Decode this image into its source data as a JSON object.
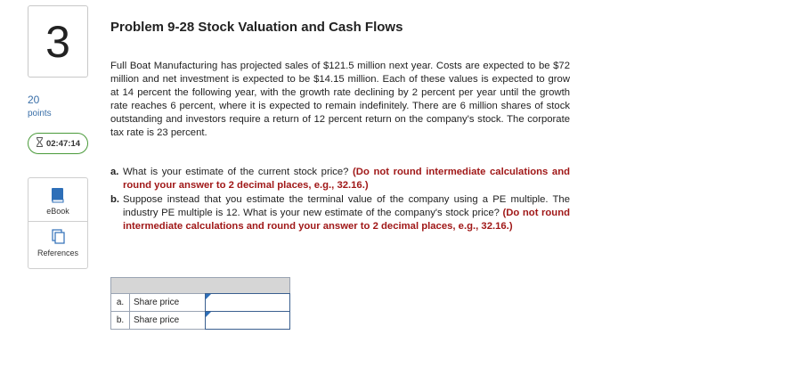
{
  "sidebar": {
    "question_number": "3",
    "points_value": "20",
    "points_label": "points",
    "timer": "02:47:14",
    "resources": [
      {
        "label": "eBook",
        "icon": "book-icon"
      },
      {
        "label": "References",
        "icon": "references-icon"
      }
    ]
  },
  "problem": {
    "title": "Problem 9-28 Stock Valuation and Cash Flows",
    "body": "Full Boat Manufacturing has projected sales of $121.5 million next year. Costs are expected to be $72 million and net investment is expected to be $14.15 million. Each of these values is expected to grow at 14 percent the following year, with the growth rate declining by 2 percent per year until the growth rate reaches 6 percent, where it is expected to remain indefinitely. There are 6 million shares of stock outstanding and investors require a return of 12 percent return on the company's stock. The corporate tax rate is 23 percent.",
    "questions": [
      {
        "letter": "a.",
        "text": "What is your estimate of the current stock price?",
        "instruction": "(Do not round intermediate calculations and round your answer to 2 decimal places, e.g., 32.16.)"
      },
      {
        "letter": "b.",
        "text": "Suppose instead that you estimate the terminal value of the company using a PE multiple. The industry PE multiple is 12. What is your new estimate of the company's stock price?",
        "instruction": "(Do not round intermediate calculations and round your answer to 2 decimal places, e.g., 32.16.)"
      }
    ]
  },
  "answers": {
    "rows": [
      {
        "letter": "a.",
        "label": "Share price",
        "value": ""
      },
      {
        "letter": "b.",
        "label": "Share price",
        "value": ""
      }
    ]
  },
  "colors": {
    "instruction": "#a01818",
    "points": "#3a6fa8",
    "timer_border": "#4a9a3a",
    "input_flag": "#2e6fb8"
  }
}
